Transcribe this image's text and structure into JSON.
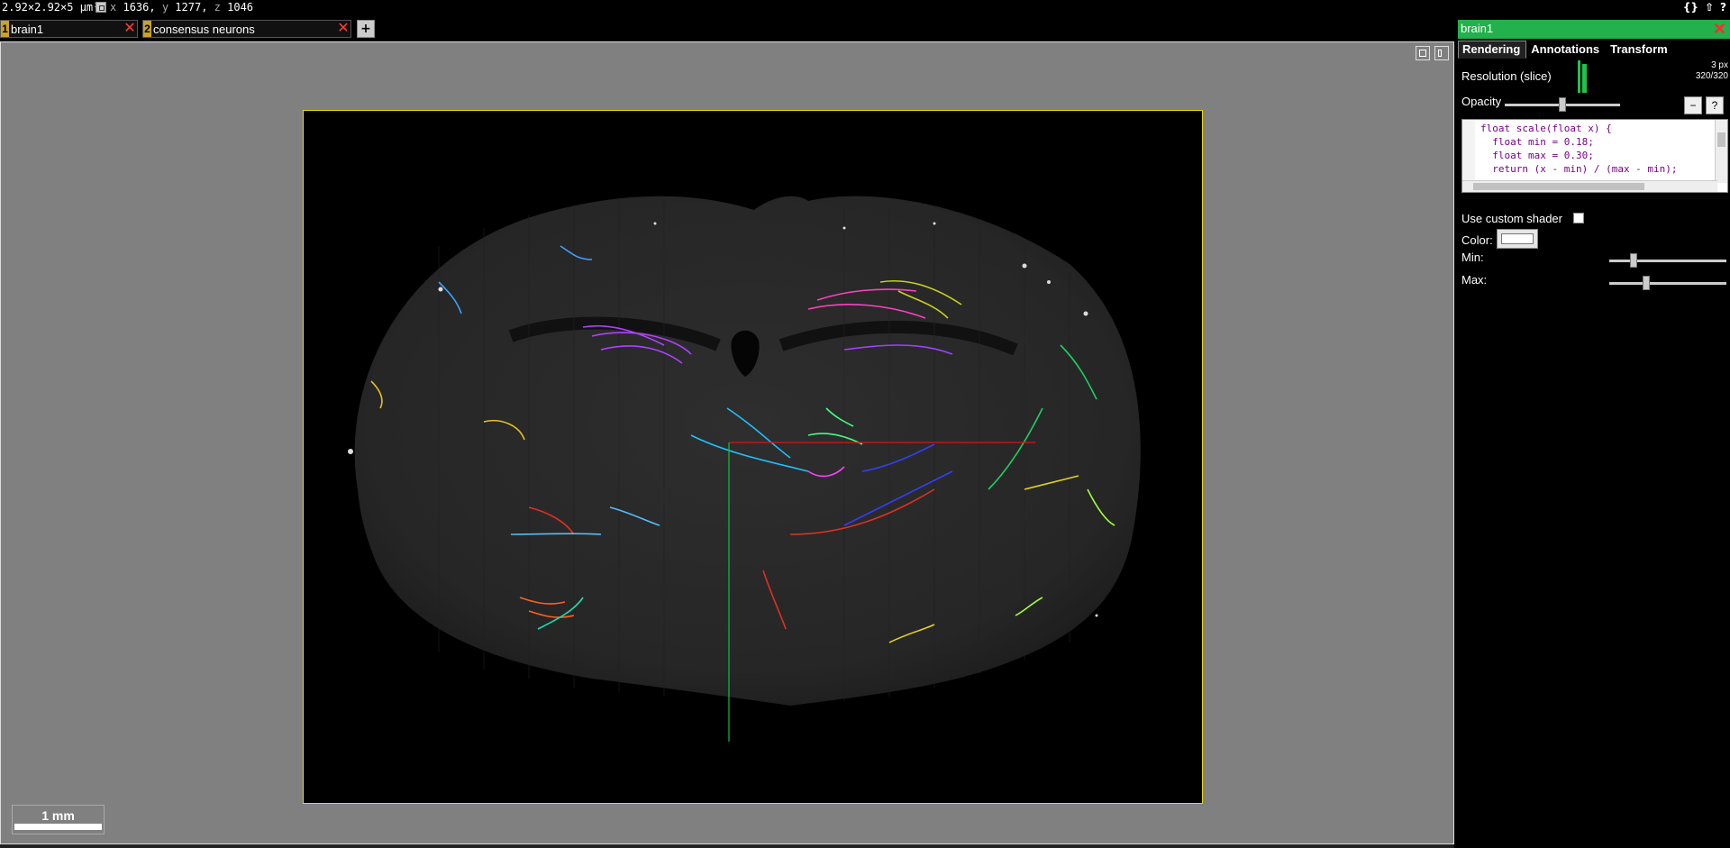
{
  "statusbar": {
    "voxel_size": "2.92×2.92×5 µm³",
    "x_label": "x",
    "x_value": "1636,",
    "y_label": "y",
    "y_value": "1277,",
    "z_label": "z",
    "z_value": "1046",
    "right_icons": [
      "{}",
      "⇧",
      "?"
    ]
  },
  "layers": [
    {
      "index": "1",
      "name": "brain1"
    },
    {
      "index": "2",
      "name": "consensus neurons"
    }
  ],
  "add_layer_label": "+",
  "scale_bar": {
    "label": "1 mm"
  },
  "side_panel": {
    "title": "brain1",
    "close_label": "✕",
    "tabs": [
      "Rendering",
      "Annotations",
      "Transform"
    ],
    "resolution_label": "Resolution (slice)",
    "resolution_value_line1": "3 px",
    "resolution_value_line2": "320/320",
    "opacity_label": "Opacity",
    "opacity_level": 0.5,
    "btn_minimize": "−",
    "btn_help": "?",
    "code_lines": [
      "float scale(float x) {",
      "  float min = 0.18;",
      "  float max = 0.30;",
      "  return (x - min) / (max - min);"
    ],
    "use_custom_shader_label": "Use custom shader",
    "color_label": "Color:",
    "min_label": "Min:",
    "max_label": "Max:",
    "min_level": 0.18,
    "max_level": 0.3
  },
  "colors": {
    "panel_border": "#e8d800",
    "title_bar": "#22b14c",
    "crosshair_x": "#e01010",
    "crosshair_y": "#10c040"
  }
}
